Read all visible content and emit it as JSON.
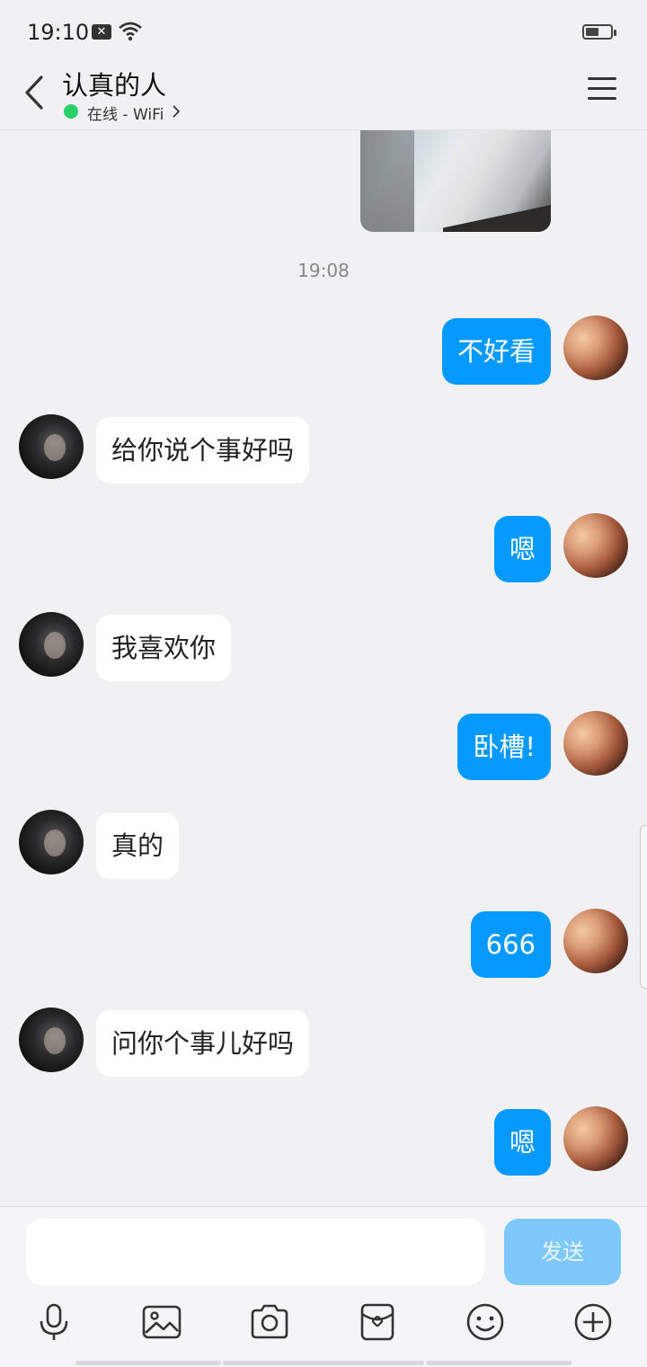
{
  "status_bar": {
    "time": "19:10",
    "notification_badge": "✕"
  },
  "header": {
    "contact_name": "认真的人",
    "presence": "在线 - WiFi"
  },
  "chat": {
    "timestamp": "19:08",
    "messages": [
      {
        "side": "mine",
        "text": "不好看"
      },
      {
        "side": "theirs",
        "text": "给你说个事好吗"
      },
      {
        "side": "mine",
        "text": "嗯"
      },
      {
        "side": "theirs",
        "text": "我喜欢你"
      },
      {
        "side": "mine",
        "text": "卧槽!"
      },
      {
        "side": "theirs",
        "text": "真的"
      },
      {
        "side": "mine",
        "text": "666"
      },
      {
        "side": "theirs",
        "text": "问你个事儿好吗"
      },
      {
        "side": "mine",
        "text": "嗯"
      }
    ]
  },
  "input_bar": {
    "placeholder": "",
    "send_label": "发送",
    "toolbar_icons": [
      "microphone-icon",
      "image-icon",
      "camera-icon",
      "red-packet-icon",
      "emoji-icon",
      "plus-icon"
    ]
  },
  "colors": {
    "accent": "#0699ff",
    "send_disabled": "#7ec8fb",
    "online": "#2ad06a"
  }
}
